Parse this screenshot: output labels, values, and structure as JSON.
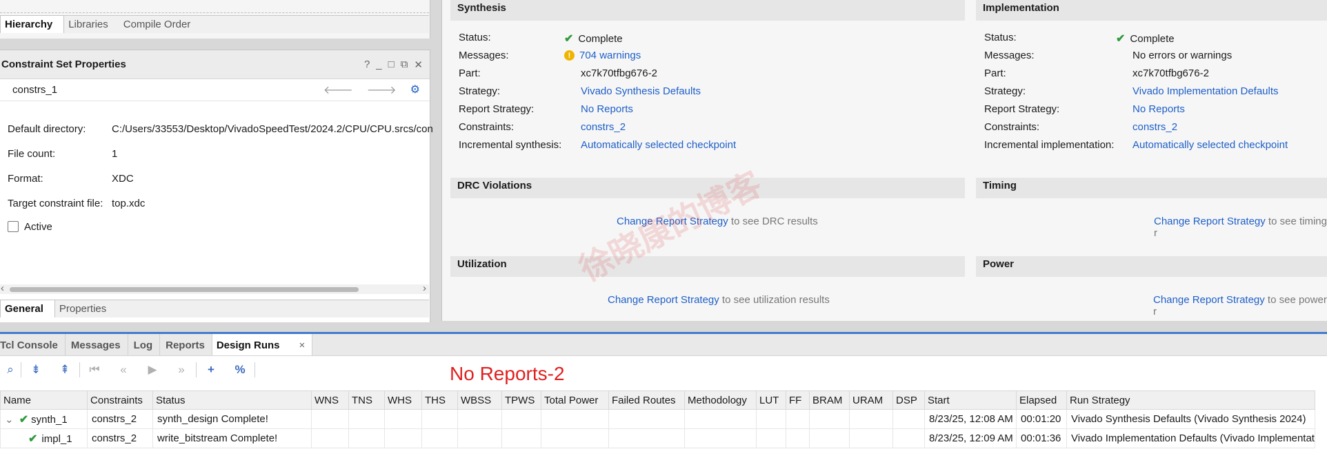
{
  "left_top_tabs": [
    "Hierarchy",
    "Libraries",
    "Compile Order"
  ],
  "props": {
    "title": "Constraint Set Properties",
    "tools": [
      "?",
      "_",
      "□",
      "⧉",
      "✕"
    ],
    "set_name": "constrs_1",
    "rows": [
      {
        "k": "Default directory:",
        "v": "C:/Users/33553/Desktop/VivadoSpeedTest/2024.2/CPU/CPU.srcs/con"
      },
      {
        "k": "File count:",
        "v": "1"
      },
      {
        "k": "Format:",
        "v": "XDC"
      },
      {
        "k": "Target constraint file:",
        "v": "top.xdc"
      }
    ],
    "active_label": "Active",
    "bottom_tabs": [
      "General",
      "Properties"
    ]
  },
  "synthesis": {
    "title": "Synthesis",
    "status_k": "Status:",
    "status_v": "Complete",
    "messages_k": "Messages:",
    "messages_v": "704 warnings",
    "part_k": "Part:",
    "part_v": "xc7k70tfbg676-2",
    "strategy_k": "Strategy:",
    "strategy_v": "Vivado Synthesis Defaults",
    "report_k": "Report Strategy:",
    "report_v": "No Reports",
    "constraints_k": "Constraints:",
    "constraints_v": "constrs_2",
    "incr_k": "Incremental synthesis:",
    "incr_v": "Automatically selected checkpoint"
  },
  "implementation": {
    "title": "Implementation",
    "status_k": "Status:",
    "status_v": "Complete",
    "messages_k": "Messages:",
    "messages_v": "No errors or warnings",
    "part_k": "Part:",
    "part_v": "xc7k70tfbg676-2",
    "strategy_k": "Strategy:",
    "strategy_v": "Vivado Implementation Defaults",
    "report_k": "Report Strategy:",
    "report_v": "No Reports",
    "constraints_k": "Constraints:",
    "constraints_v": "constrs_2",
    "incr_k": "Incremental implementation:",
    "incr_v": "Automatically selected checkpoint"
  },
  "drc": {
    "title": "DRC Violations",
    "link": "Change Report Strategy",
    "rest": " to see DRC results"
  },
  "timing": {
    "title": "Timing",
    "link": "Change Report Strategy",
    "rest": " to see timing r"
  },
  "util": {
    "title": "Utilization",
    "link": "Change Report Strategy",
    "rest": " to see utilization results"
  },
  "power": {
    "title": "Power",
    "link": "Change Report Strategy",
    "rest": " to see power r"
  },
  "bottom_tabs": [
    "Tcl Console",
    "Messages",
    "Log",
    "Reports",
    "Design Runs"
  ],
  "annotation": "No Reports-2",
  "watermark": "徐晓康的博客",
  "table": {
    "headers": [
      "Name",
      "Constraints",
      "Status",
      "WNS",
      "TNS",
      "WHS",
      "THS",
      "WBSS",
      "TPWS",
      "Total Power",
      "Failed Routes",
      "Methodology",
      "LUT",
      "FF",
      "BRAM",
      "URAM",
      "DSP",
      "Start",
      "Elapsed",
      "Run Strategy"
    ],
    "rows": [
      [
        "synth_1",
        "constrs_2",
        "synth_design Complete!",
        "",
        "",
        "",
        "",
        "",
        "",
        "",
        "",
        "",
        "",
        "",
        "",
        "",
        "",
        "8/23/25, 12:08 AM",
        "00:01:20",
        "Vivado Synthesis Defaults (Vivado Synthesis 2024)"
      ],
      [
        "impl_1",
        "constrs_2",
        "write_bitstream Complete!",
        "",
        "",
        "",
        "",
        "",
        "",
        "",
        "",
        "",
        "",
        "",
        "",
        "",
        "",
        "8/23/25, 12:09 AM",
        "00:01:36",
        "Vivado Implementation Defaults (Vivado Implementat"
      ]
    ]
  },
  "colors": {
    "accent": "#3f7ad0",
    "link": "#1e5fc8",
    "ok": "#2f9a3c",
    "warn": "#f0b400",
    "annotation": "#e02020"
  }
}
